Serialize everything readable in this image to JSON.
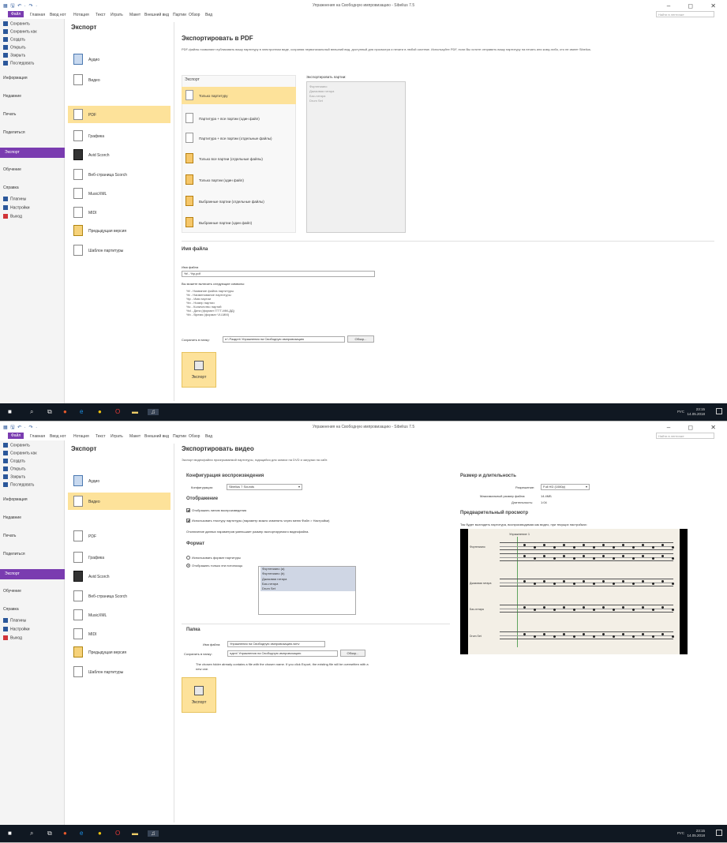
{
  "app": {
    "window_title": "Упражнения на Свободную импровизацию - Sibelius 7.5",
    "quick_access": "▦ 🖫 ↶ · ↷ ·",
    "window_controls": "–  ◻  ✕"
  },
  "menu": {
    "items": [
      "Файл",
      "Главная",
      "Ввод нот",
      "Нотация",
      "Текст",
      "Играть",
      "Макет",
      "Внешний вид",
      "Партии",
      "Обзор",
      "Вид"
    ],
    "search_placeholder": "Найти в ленточке"
  },
  "sidebar": {
    "items": [
      "Сохранить",
      "Сохранить как",
      "Создать",
      "Открыть",
      "Закрыть",
      "Последовать",
      "Информация",
      "Недавние",
      "Печать",
      "Поделиться",
      "Экспорт",
      "Обучение",
      "Справка",
      "Плагины",
      "Настройки",
      "Выход"
    ]
  },
  "export_panel": {
    "title": "Экспорт",
    "types": [
      "Аудио",
      "Видео",
      "PDF",
      "Графика",
      "Avid Scorch",
      "Веб-страница Scorch",
      "MusicXML",
      "MIDI",
      "Предыдущая версия",
      "Шаблон партитуры"
    ]
  },
  "screen1": {
    "heading": "Экспортировать в PDF",
    "description": "PDF-файлы позволяют публиковать вашу партитуру в электронном виде, сохраняя первоначальный внешний вид, доступный для просмотра и печати в любой системе. Используйте PDF, если Вы хотите отправить вашу партитуру на печать или кому-либо, кто не имеет Sibelius.",
    "export_label": "Экспорт",
    "options": [
      "Только партитуру",
      "Партитура + все партии (один файл)",
      "Партитура + все партии (отдельные файлы)",
      "Только все партии (отдельные файлы)",
      "Только партии (один файл)",
      "Выбранные партии (отдельные файлы)",
      "Выбранные партии (один файл)"
    ],
    "export_parts_label": "Экспортировать партии:",
    "parts": [
      "Фортепиано",
      "Джазовая гитара",
      "Бас-гитара",
      "Drum Set"
    ],
    "filename_section": "Имя файла",
    "filename_label": "Имя файла",
    "filename_value": "%f - %p.pdf",
    "symbols_intro": "Вы можете включить следующие символы:",
    "symbols": [
      "%f - Название файла партитуры",
      "%t - Наименование партитуры",
      "%p - Имя партии",
      "%n - Номер партии",
      "%c - Количество партий",
      "%d - Дата (формат ГГГГ-ММ-ДД)",
      "%h - Время (формат ЧЧ-ММ)"
    ],
    "save_to_label": "Сохранить в папку:",
    "save_to_value": "e:\\ Раздел\\ Упражнения на Свободную импровизацию",
    "browse": "Обзор...",
    "export_button": "Экспорт"
  },
  "screen2": {
    "heading": "Экспортировать видео",
    "description": "Экспорт видеофайла проигрываемой партитуры, годящийся для записи на DVD и загрузки на сайт.",
    "playback_config": "Конфигурация воспроизведения",
    "config_label": "Конфигурация:",
    "config_value": "Sibelius 7 Sounds",
    "display_section": "Отображение",
    "display_opt1": "Отображать линию воспроизведения",
    "display_opt2": "Использовать текстуру партитуры (параметр можно изменить через меню Файл > Настройки)",
    "display_note": "Отключение данных параметров уменьшает размер экспортируемого видеофайла.",
    "format_section": "Формат",
    "format_opt1": "Использовать формат партитуры",
    "format_opt2": "Отображать только эти нотоносцы",
    "staves": [
      "Фортепиано (a)",
      "Фортепиано (b)",
      "Джазовая гитара",
      "Бас-гитара",
      "Drum Set"
    ],
    "folder_section": "Папка",
    "filename_label": "Имя файла:",
    "filename_value": "Упражнения на Свободную импровизацию.wmv",
    "save_to_label": "Сохранить в папку:",
    "save_to_value": "ндел\\ Упражнения на Свободную импровизацию",
    "browse": "Обзор...",
    "warning": "The chosen folder already contains a file with the chosen name. If you click Export, the existing file will be overwritten with a new one.",
    "export_button": "Экспорт",
    "size_section": "Размер и длительность",
    "resolution_label": "Разрешение:",
    "resolution_value": "Full HD (1080p)",
    "max_size_label": "Максимальный размер файла:",
    "max_size_value": "14.4МБ",
    "duration_label": "Длительность:",
    "duration_value": "1:04",
    "preview_section": "Предварительный просмотр",
    "preview_caption": "Так будет выглядеть партитура, воспроизводимая как видео, при текущих настройках:",
    "preview_title": "Упражнение 1",
    "preview_staves": [
      "Фортепиано",
      "Джазовая гитара",
      "Бас-гитара",
      "Drum Set"
    ]
  },
  "taskbar": {
    "lang": "РУС",
    "time": "23:15",
    "date": "14.05.2018"
  }
}
